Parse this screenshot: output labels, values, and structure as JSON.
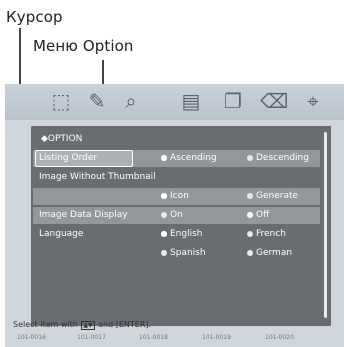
{
  "callouts": {
    "cursor_label": "Курсор",
    "menu_label": "Меню Option"
  },
  "toolbar": {
    "icons": [
      "zoom-icon",
      "palette-icon",
      "magnify-icon",
      "toolbox-icon",
      "copy-icon",
      "trash-icon",
      "search-icon"
    ]
  },
  "panel": {
    "title": "◆OPTION",
    "rows": [
      {
        "label": "Listing Order",
        "options": [
          "Ascending",
          "Descending"
        ],
        "selected": 0
      },
      {
        "label": "Image Without Thumbnail",
        "options": [],
        "selected": -1
      },
      {
        "label": "",
        "options": [
          "Icon",
          "Generate"
        ],
        "selected": 0
      },
      {
        "label": "Image Data Display",
        "options": [
          "On",
          "Off"
        ],
        "selected": 1
      },
      {
        "label": "Language",
        "options": [
          "English",
          "French"
        ],
        "selected": 0
      },
      {
        "label": "",
        "options": [
          "Spanish",
          "German"
        ],
        "selected": -1
      }
    ]
  },
  "thumbnails": [
    "101-0016",
    "101-0017",
    "101-0018",
    "101-0019",
    "101-0020"
  ],
  "status": {
    "prefix": "Select item with",
    "suffix": "and [ENTER]."
  }
}
